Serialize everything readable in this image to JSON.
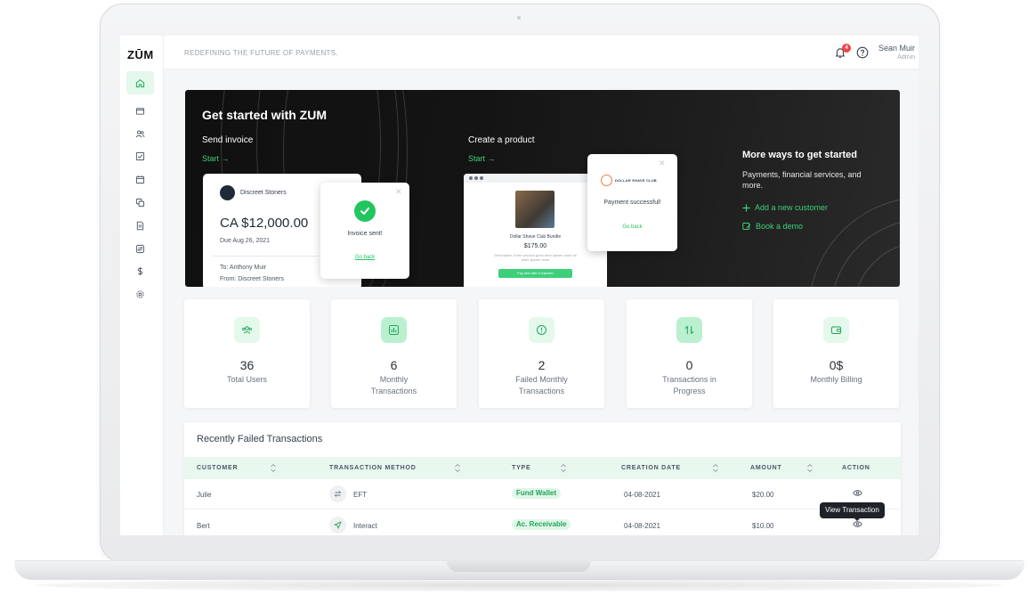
{
  "app": {
    "logo": "ZŪM",
    "tagline": "REDEFINING THE FUTURE OF PAYMENTS."
  },
  "header": {
    "notification_count": "4",
    "user_name": "Sean Muir",
    "user_role": "Admin"
  },
  "sidebar": {
    "items": [
      {
        "icon": "home-icon",
        "active": true
      },
      {
        "icon": "wallet-icon",
        "active": false
      },
      {
        "icon": "users-icon",
        "active": false
      },
      {
        "icon": "checklist-icon",
        "active": false
      },
      {
        "icon": "calendar-icon",
        "active": false
      },
      {
        "icon": "copy-icon",
        "active": false
      },
      {
        "icon": "document-icon",
        "active": false
      },
      {
        "icon": "transfer-icon",
        "active": false
      },
      {
        "icon": "dollar-icon",
        "active": false
      },
      {
        "icon": "gear-icon",
        "active": false
      }
    ]
  },
  "hero": {
    "title": "Get started with ZUM",
    "send_invoice": {
      "label": "Send invoice",
      "link": "Start →",
      "card": {
        "company": "Discreet Stoners",
        "amount": "CA $12,000.00",
        "due": "Due Aug 26, 2021",
        "to_label": "To:",
        "to_value": "Anthony Muir",
        "from_label": "From:",
        "from_value": "Discreet Stoners"
      },
      "popup": {
        "message": "Invoice sent!",
        "link": "Go back"
      }
    },
    "create_product": {
      "label": "Create a product",
      "link": "Start →",
      "card": {
        "name": "Dollar Shave Club Bundle",
        "price": "$175.00",
        "description": "Description of the product goes here lipsum dolor sit amet lipsum dolor",
        "button": "Pay fast with e-transfer"
      },
      "popup": {
        "brand": "DOLLAR SHAVE CLUB",
        "message": "Payment successful!",
        "link": "Go back"
      }
    },
    "more": {
      "title": "More ways to get started",
      "text": "Payments, financial services, and more.",
      "actions": [
        "Add a new customer",
        "Book a demo"
      ]
    }
  },
  "stats": [
    {
      "value": "36",
      "label": "Total Users",
      "icon": "users-icon"
    },
    {
      "value": "6",
      "label": "Monthly Transactions",
      "icon": "bar-chart-icon"
    },
    {
      "value": "2",
      "label": "Failed Monthly Transactions",
      "icon": "alert-circle-icon"
    },
    {
      "value": "0",
      "label": "Transactions in Progress",
      "icon": "arrows-up-down-icon"
    },
    {
      "value": "0$",
      "label": "Monthly Billing",
      "icon": "wallet-icon"
    }
  ],
  "table": {
    "title": "Recently Failed Transactions",
    "columns": [
      "CUSTOMER",
      "TRANSACTION METHOD",
      "TYPE",
      "CREATION DATE",
      "AMOUNT",
      "ACTION"
    ],
    "rows": [
      {
        "customer": "Julie",
        "method": "EFT",
        "method_icon": "transfer-icon",
        "type": "Fund Wallet",
        "date": "04-08-2021",
        "amount": "$20.00",
        "action_icon": "eye-icon"
      },
      {
        "customer": "Bert",
        "method": "Interact",
        "method_icon": "send-icon",
        "type": "Ac. Receivable",
        "date": "04-08-2021",
        "amount": "$10.00",
        "action_icon": "eye-icon"
      }
    ],
    "tooltip": "View Transaction"
  },
  "colors": {
    "accent": "#3ecf7a",
    "accent_light": "#e4f8ec",
    "badge_red": "#ef4444",
    "hero_bg": "#141414"
  }
}
